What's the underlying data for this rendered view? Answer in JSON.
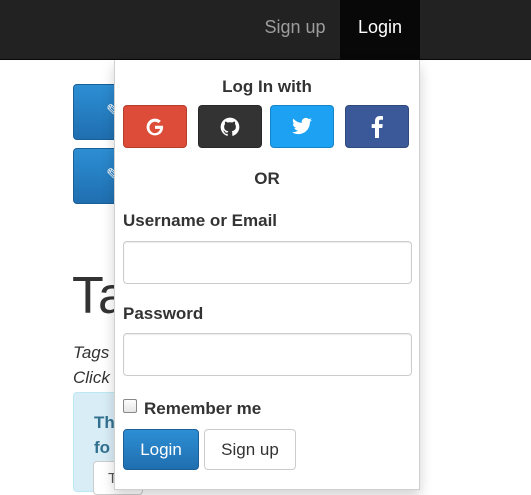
{
  "navbar": {
    "signup_label": "Sign up",
    "login_label": "Login"
  },
  "background": {
    "title_fragment": "Ta",
    "line1_fragment": "Tags",
    "line2_fragment": "Click",
    "alert_line1_fragment": "Th",
    "alert_line2_fragment": "fo",
    "alert_input_fragment": "T"
  },
  "login_panel": {
    "heading": "Log In with",
    "social": [
      {
        "name": "google",
        "icon": "google-icon",
        "color": "#dd4b39"
      },
      {
        "name": "github",
        "icon": "github-icon",
        "color": "#333333"
      },
      {
        "name": "twitter",
        "icon": "twitter-icon",
        "color": "#1da1f2"
      },
      {
        "name": "facebook",
        "icon": "facebook-icon",
        "color": "#3b5998"
      }
    ],
    "or_text": "OR",
    "username_label": "Username or Email",
    "username_value": "",
    "password_label": "Password",
    "password_value": "",
    "remember_label": "Remember me",
    "remember_checked": false,
    "login_button": "Login",
    "signup_button": "Sign up"
  },
  "colors": {
    "navbar_bg": "#222222",
    "primary": "#1f6fb0"
  }
}
